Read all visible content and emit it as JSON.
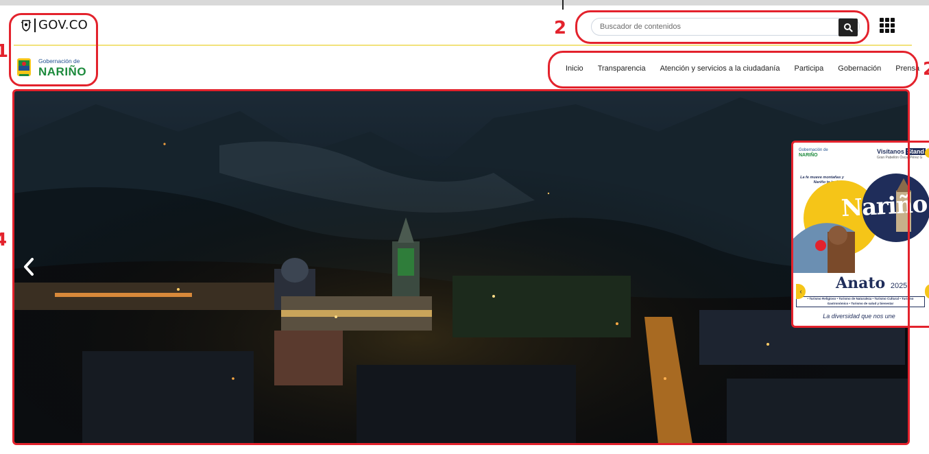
{
  "header": {
    "gov_logo_text": "GOV.CO",
    "nar_logo_sub": "Gobernación de",
    "nar_logo_main": "NARIÑO"
  },
  "search": {
    "placeholder": "Buscador de contenidos",
    "value": "",
    "button_icon": "search-icon"
  },
  "apps_icon": "grid-apps-icon",
  "nav": {
    "items": [
      {
        "label": "Inicio"
      },
      {
        "label": "Transparencia"
      },
      {
        "label": "Atención y servicios a la ciudadanía"
      },
      {
        "label": "Participa"
      },
      {
        "label": "Gobernación"
      },
      {
        "label": "Prensa"
      }
    ]
  },
  "annotations": [
    "1",
    "2",
    "2",
    "4"
  ],
  "hero": {
    "prev_icon": "chevron-left-icon"
  },
  "promo": {
    "head_sub": "Gobernación de",
    "head_main": "NARIÑO",
    "visit": "Visítanos",
    "stand": "Stand",
    "pavilion": "Gran Pabellón Óscar Pérez G",
    "tagline": "La fe mueve montañas y Nariño te invita a explorarlas",
    "big_title": "Nariño",
    "event": "Anato",
    "year": "2025",
    "tourism": "• Turismo Religioso • Turismo de Naturaleza • Turismo Cultural • Turismo Gastronómico • Turismo de salud y bienestar",
    "slogan": "La diversidad que nos une"
  },
  "colors": {
    "annotation_red": "#e3222c",
    "divider_yellow": "#f2e27a",
    "brand_green": "#1c8a3c",
    "brand_blue": "#1f4f8f",
    "promo_navy": "#1f2d5a"
  }
}
